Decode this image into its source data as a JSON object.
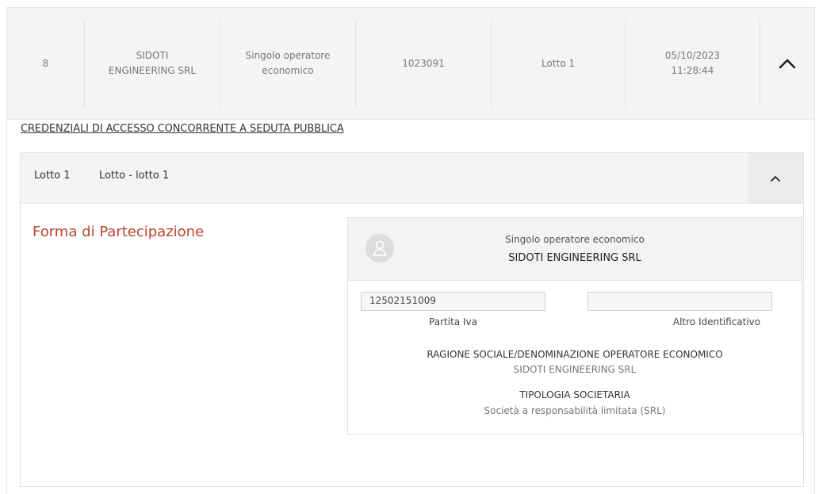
{
  "summary_row": {
    "index": "8",
    "company": "SIDOTI\nENGINEERING SRL",
    "participation": "Singolo operatore\neconomico",
    "code": "1023091",
    "lot": "Lotto 1",
    "datetime": "05/10/2023\n11:28:44",
    "toggle_icon": "chevron-up-icon"
  },
  "credentials_link": "CREDENZIALI DI ACCESSO CONCORRENTE A SEDUTA PUBBLICA",
  "lotto_panel": {
    "lot_number": "Lotto 1",
    "lot_name": "Lotto - lotto 1",
    "toggle_icon": "chevron-up-icon"
  },
  "forma_partecipazione": {
    "title": "Forma di Partecipazione",
    "operator": {
      "avatar_icon": "user-icon",
      "type": "Singolo operatore economico",
      "name": "SIDOTI ENGINEERING SRL",
      "partita_iva": {
        "value": "12502151009",
        "label": "Partita Iva"
      },
      "altro_identificativo": {
        "value": "",
        "label": "Altro Identificativo"
      },
      "ragione_sociale": {
        "label": "RAGIONE SOCIALE/DENOMINAZIONE OPERATORE ECONOMICO",
        "value": "SIDOTI ENGINEERING SRL"
      },
      "tipologia": {
        "label": "TIPOLOGIA SOCIETARIA",
        "value": "Società a responsabilità limitata (SRL)"
      }
    }
  }
}
